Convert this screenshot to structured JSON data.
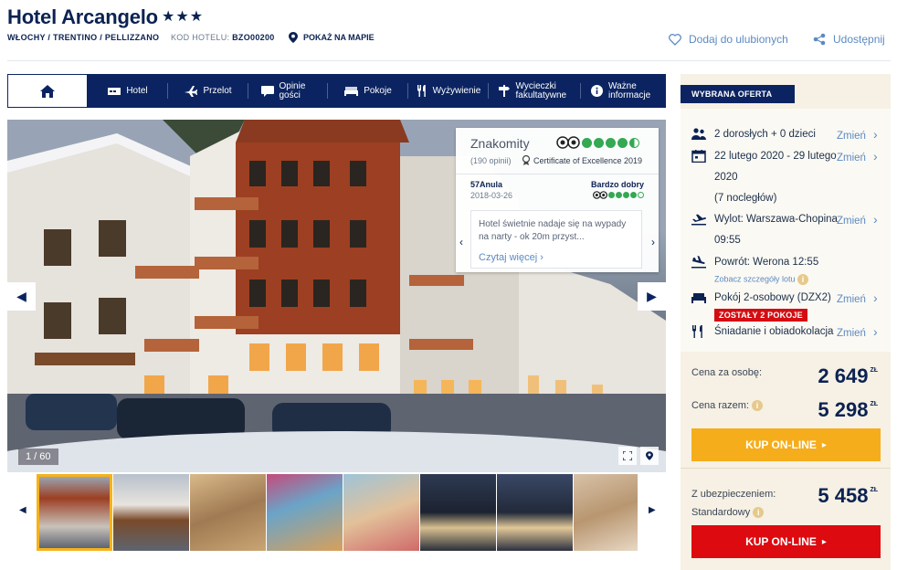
{
  "hotel": {
    "name": "Hotel Arcangelo",
    "stars": "★★★",
    "breadcrumb": "WŁOCHY / TRENTINO / PELLIZZANO",
    "code_label": "KOD HOTELU:",
    "code_value": "BZO00200",
    "map_link": "POKAŻ NA MAPIE",
    "favorite": "Dodaj do ulubionych",
    "share": "Udostępnij"
  },
  "nav": {
    "items": [
      {
        "label": "Hotel",
        "icon": "hotel-icon"
      },
      {
        "label": "Przelot",
        "icon": "plane-icon"
      },
      {
        "label": "Opinie gości",
        "icon": "speech-bubble-icon"
      },
      {
        "label": "Pokoje",
        "icon": "bed-icon"
      },
      {
        "label": "Wyżywienie",
        "icon": "cutlery-icon"
      },
      {
        "label": "Wycieczki fakultatywne",
        "icon": "signpost-icon"
      },
      {
        "label": "Ważne informacje",
        "icon": "info-icon"
      }
    ]
  },
  "gallery": {
    "counter": "1 / 60"
  },
  "review": {
    "summary": "Znakomity",
    "count": "(190 opinii)",
    "certificate": "Certificate of Excellence 2019",
    "overall_bubbles": 4.5,
    "user": "57Anula",
    "date": "2018-03-26",
    "rating_label": "Bardzo dobry",
    "user_bubbles": 4,
    "quote": "Hotel świetnie nadaje się na wypady na narty - ok 20m przyst...",
    "read_more": "Czytaj więcej"
  },
  "offer": {
    "badge": "WYBRANA OFERTA",
    "change_label": "Zmień",
    "guests": "2 dorosłych + 0 dzieci",
    "dates": "22 lutego 2020 - 29 lutego 2020",
    "nights": "(7 nocległów)",
    "departure": "Wylot: Warszawa-Chopina 09:55",
    "return": "Powrót: Werona 12:55",
    "flight_details": "Zobacz szczegóły lotu",
    "room": "Pokój 2-osobowy (DZX2)",
    "rooms_left": "ZOSTAŁY 2 POKOJE",
    "board": "Śniadanie i obiadokolacja",
    "price_person_label": "Cena za osobę:",
    "price_person": "2 649",
    "price_total_label": "Cena razem:",
    "price_total": "5 298",
    "currency": "ZŁ",
    "buy_label": "KUP ON-LINE",
    "insurance_label": "Z ubezpieczeniem:",
    "insurance_type": "Standardowy",
    "price_insured": "5 458"
  }
}
